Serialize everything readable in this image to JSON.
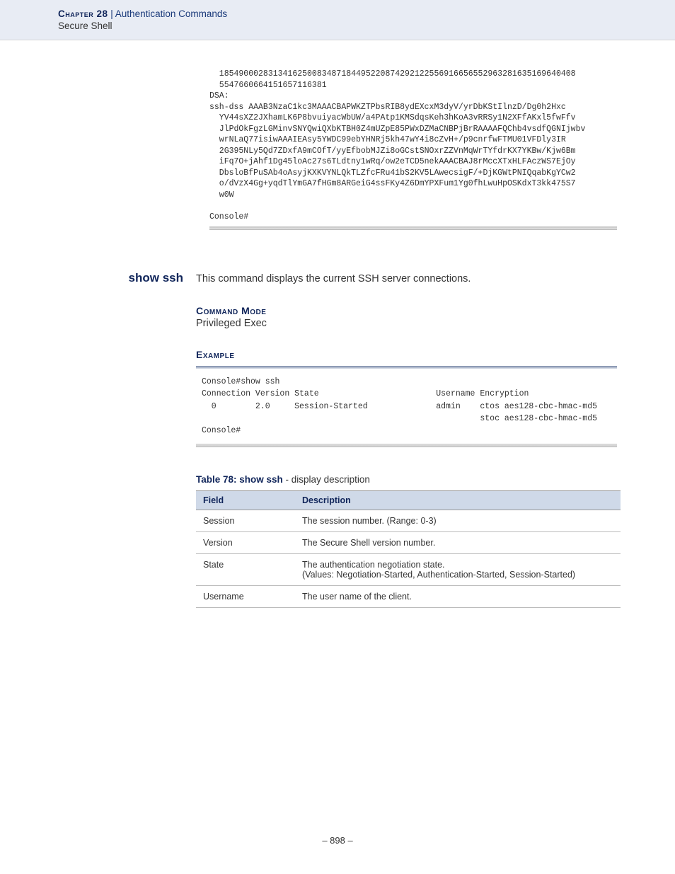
{
  "header": {
    "chapter_label": "Chapter 28",
    "separator": "  |  ",
    "chapter_title": "Authentication Commands",
    "section": "Secure Shell"
  },
  "top_code": "  1854900028313416250083487184495220874292122556916656552963281635169640408\n  5547660664151657116381\nDSA:\nssh-dss AAAB3NzaC1kc3MAAACBAPWKZTPbsRIB8ydEXcxM3dyV/yrDbKStIlnzD/Dg0h2Hxc\n  YV44sXZ2JXhamLK6P8bvuiyacWbUW/a4PAtp1KMSdqsKeh3hKoA3vRRSy1N2XFfAKxl5fwFfv\n  JlPdOkFgzLGMinvSNYQwiQXbKTBH0Z4mUZpE85PWxDZMaCNBPjBrRAAAAFQChb4vsdfQGNIjwbv\n  wrNLaQ77isiwAAAIEAsy5YWDC99ebYHNRj5kh47wY4i8cZvH+/p9cnrfwFTMU01VFDly3IR\n  2G395NLy5Qd7ZDxfA9mCOfT/yyEfbobMJZi8oGCstSNOxrZZVnMqWrTYfdrKX7YKBw/Kjw6Bm\n  iFq7O+jAhf1Dg45loAc27s6TLdtny1wRq/ow2eTCD5nekAAACBAJ8rMccXTxHLFAczWS7EjOy\n  DbsloBfPuSAb4oAsyjKXKVYNLQkTLZfcFRu41bS2KV5LAwecsigF/+DjKGWtPNIQqabKgYCw2\n  o/dVzX4Gg+yqdTlYmGA7fHGm8ARGeiG4ssFKy4Z6DmYPXFum1Yg0fhLwuHpOSKdxT3kk475S7\n  w0W\n\nConsole#",
  "command": {
    "name": "show ssh",
    "description": "This command displays the current SSH server connections."
  },
  "mode": {
    "heading": "Command Mode",
    "value": "Privileged Exec"
  },
  "example": {
    "heading": "Example",
    "code": "Console#show ssh\nConnection Version State                        Username Encryption\n  0        2.0     Session-Started              admin    ctos aes128-cbc-hmac-md5\n                                                         stoc aes128-cbc-hmac-md5\nConsole#"
  },
  "table": {
    "label": "Table 78: show ssh",
    "suffix": " - display description",
    "headers": {
      "field": "Field",
      "desc": "Description"
    },
    "rows": [
      {
        "field": "Session",
        "desc": "The session number. (Range: 0-3)"
      },
      {
        "field": "Version",
        "desc": "The Secure Shell version number."
      },
      {
        "field": "State",
        "desc": "The authentication negotiation state.\n(Values: Negotiation-Started, Authentication-Started, Session-Started)"
      },
      {
        "field": "Username",
        "desc": "The user name of the client."
      }
    ]
  },
  "footer": "– 898 –"
}
